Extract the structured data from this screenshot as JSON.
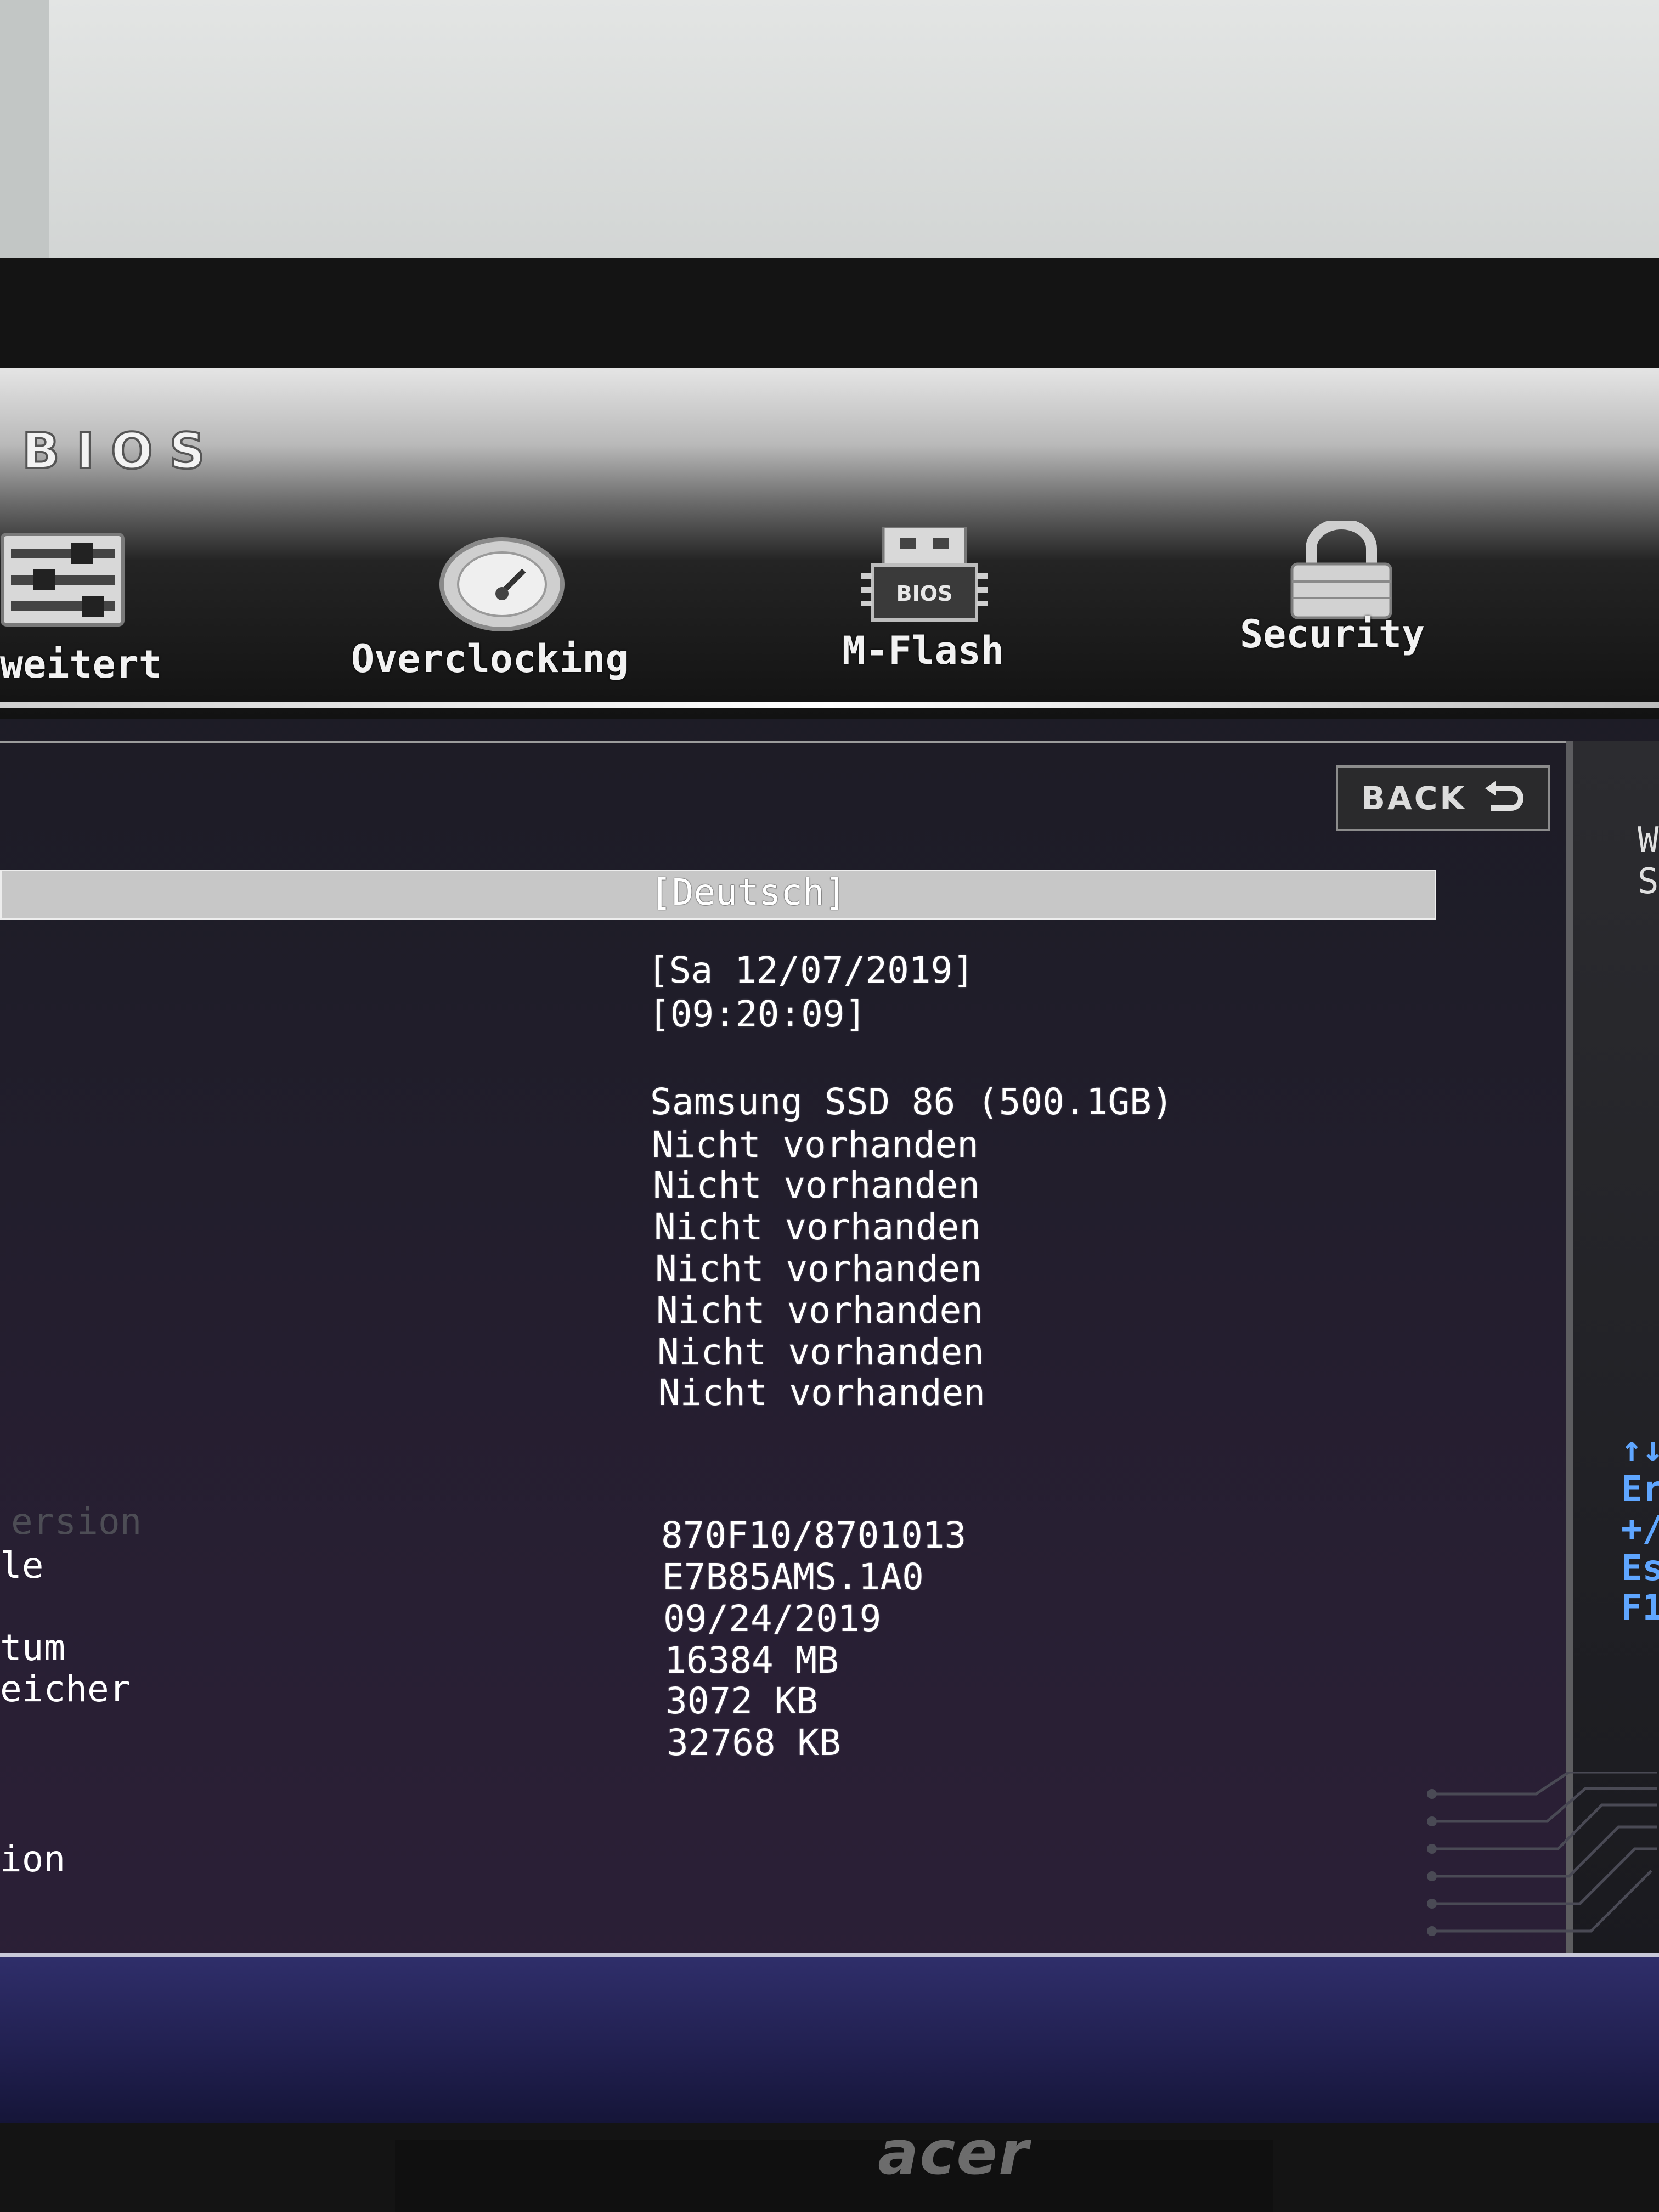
{
  "header": {
    "logo": "BIOS",
    "nav": [
      {
        "label": "weitert",
        "icon": "settings-sliders-icon"
      },
      {
        "label": "Overclocking",
        "icon": "speedometer-icon"
      },
      {
        "label": "M-Flash",
        "icon": "bios-chip-icon",
        "chip_text": "BIOS"
      },
      {
        "label": "Security",
        "icon": "padlock-icon"
      }
    ]
  },
  "back_button": {
    "label": "BACK",
    "icon": "return-arrow-icon"
  },
  "settings": {
    "language": "[Deutsch]",
    "date": "[Sa 12/07/2019]",
    "time": "[09:20:09]",
    "drives": [
      "Samsung SSD 86 (500.1GB)",
      "Nicht vorhanden",
      "Nicht vorhanden",
      "Nicht vorhanden",
      "Nicht vorhanden",
      "Nicht vorhanden",
      "Nicht vorhanden",
      "Nicht vorhanden"
    ],
    "system_info": [
      "870F10/8701013",
      "E7B85AMS.1A0",
      "09/24/2019",
      "16384 MB",
      "3072 KB",
      "32768 KB"
    ]
  },
  "left_labels": {
    "dim": "ersion",
    "row1": "le",
    "row2": "tum",
    "row3": "eicher",
    "row4": "ion"
  },
  "help": {
    "keys": [
      "↑↓",
      "Er",
      "+/",
      "Es",
      "F1"
    ],
    "text": [
      "W",
      "S"
    ]
  },
  "monitor_brand": "acer",
  "colors": {
    "help_key": "#5fa6ff",
    "highlight_bar": "#c7c7c7",
    "bottom_band": "#2f2e6a"
  }
}
